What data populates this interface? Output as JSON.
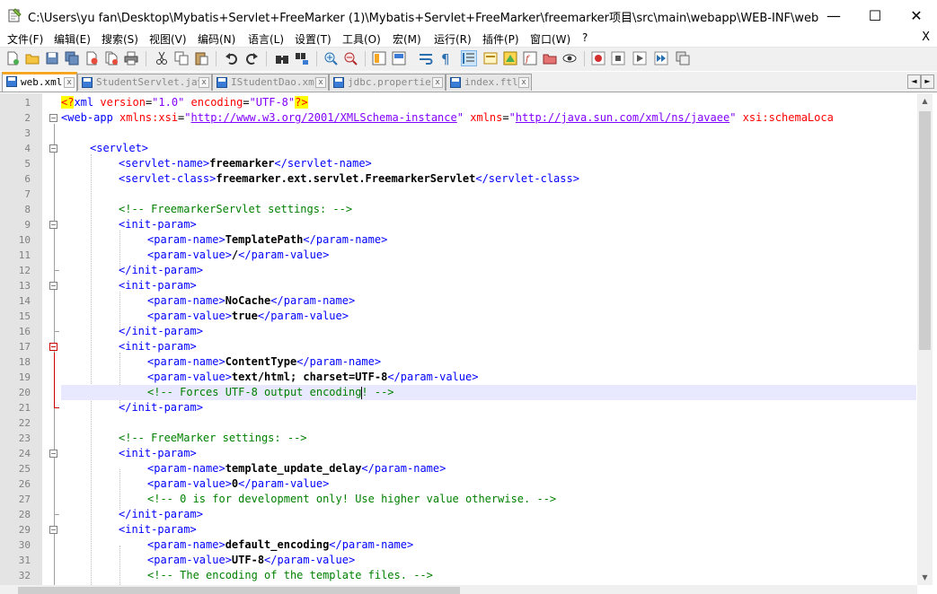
{
  "window": {
    "title": "C:\\Users\\yu   fan\\Desktop\\Mybatis+Servlet+FreeMarker (1)\\Mybatis+Servlet+FreeMarker\\freemarker项目\\src\\main\\webapp\\WEB-INF\\web.xml - Not...",
    "minimize": "—",
    "maximize": "☐",
    "close": "✕"
  },
  "menu": {
    "items": [
      "文件(F)",
      "编辑(E)",
      "搜索(S)",
      "视图(V)",
      "编码(N)",
      "语言(L)",
      "设置(T)",
      "工具(O)",
      "宏(M)",
      "运行(R)",
      "插件(P)",
      "窗口(W)",
      "?"
    ],
    "close": "X"
  },
  "toolbar": {
    "icons": [
      "new-file-icon",
      "open-file-icon",
      "save-icon",
      "save-all-icon",
      "close-icon",
      "close-all-icon",
      "print-icon",
      "cut-icon",
      "copy-icon",
      "paste-icon",
      "undo-icon",
      "redo-icon",
      "find-icon",
      "replace-icon",
      "zoom-in-icon",
      "zoom-out-icon",
      "sync-vertical-icon",
      "sync-horizontal-icon",
      "word-wrap-icon",
      "show-all-chars-icon",
      "indent-guide-icon",
      "user-language-icon",
      "doc-map-icon",
      "function-list-icon",
      "folder-workspace-icon",
      "monitoring-icon",
      "record-macro-icon",
      "stop-macro-icon",
      "play-macro-icon",
      "run-macro-multiple-icon",
      "save-macro-icon"
    ]
  },
  "tabs": [
    {
      "label": "web.xml",
      "active": true,
      "close": "x"
    },
    {
      "label": "StudentServlet.java",
      "active": false,
      "close": "x"
    },
    {
      "label": "IStudentDao.xml",
      "active": false,
      "close": "x"
    },
    {
      "label": "jdbc.properties",
      "active": false,
      "close": "x"
    },
    {
      "label": "index.ftl",
      "active": false,
      "close": "x"
    }
  ],
  "tab_nav": {
    "left": "◄",
    "right": "►"
  },
  "editor": {
    "current_line": 20,
    "lines": [
      {
        "n": "1"
      },
      {
        "n": "2"
      },
      {
        "n": "3"
      },
      {
        "n": "4"
      },
      {
        "n": "5"
      },
      {
        "n": "6"
      },
      {
        "n": "7"
      },
      {
        "n": "8"
      },
      {
        "n": "9"
      },
      {
        "n": "10"
      },
      {
        "n": "11"
      },
      {
        "n": "12"
      },
      {
        "n": "13"
      },
      {
        "n": "14"
      },
      {
        "n": "15"
      },
      {
        "n": "16"
      },
      {
        "n": "17"
      },
      {
        "n": "18"
      },
      {
        "n": "19"
      },
      {
        "n": "20"
      },
      {
        "n": "21"
      },
      {
        "n": "22"
      },
      {
        "n": "23"
      },
      {
        "n": "24"
      },
      {
        "n": "25"
      },
      {
        "n": "26"
      },
      {
        "n": "27"
      },
      {
        "n": "28"
      },
      {
        "n": "29"
      },
      {
        "n": "30"
      },
      {
        "n": "31"
      },
      {
        "n": "32"
      }
    ],
    "code": {
      "l1_open": "<?",
      "l1_xml": "xml",
      "l1_version_attr": " version",
      "l1_eq1": "=",
      "l1_version_val": "\"1.0\"",
      "l1_encoding_attr": " encoding",
      "l1_eq2": "=",
      "l1_encoding_val": "\"UTF-8\"",
      "l1_close": "?>",
      "l2_tag": "<web-app",
      "l2_attr1": " xmlns:xsi",
      "l2_eq1": "=",
      "l2_q1": "\"",
      "l2_url1": "http://www.w3.org/2001/XMLSchema-instance",
      "l2_q2": "\"",
      "l2_attr2": " xmlns",
      "l2_eq2": "=",
      "l2_q3": "\"",
      "l2_url2": "http://java.sun.com/xml/ns/javaee",
      "l2_q4": "\"",
      "l2_attr3": " xsi:schemaLoca",
      "l4": "<servlet>",
      "l5_open": "<servlet-name>",
      "l5_text": "freemarker",
      "l5_close": "</servlet-name>",
      "l6_open": "<servlet-class>",
      "l6_text": "freemarker.ext.servlet.FreemarkerServlet",
      "l6_close": "</servlet-class>",
      "l8": "<!-- FreemarkerServlet settings: -->",
      "l9": "<init-param>",
      "l10_open": "<param-name>",
      "l10_text": "TemplatePath",
      "l10_close": "</param-name>",
      "l11_open": "<param-value>",
      "l11_text": "/",
      "l11_close": "</param-value>",
      "l12": "</init-param>",
      "l13": "<init-param>",
      "l14_open": "<param-name>",
      "l14_text": "NoCache",
      "l14_close": "</param-name>",
      "l15_open": "<param-value>",
      "l15_text": "true",
      "l15_close": "</param-value>",
      "l16": "</init-param>",
      "l17": "<init-param>",
      "l18_open": "<param-name>",
      "l18_text": "ContentType",
      "l18_close": "</param-name>",
      "l19_open": "<param-value>",
      "l19_text": "text/html; charset=UTF-8",
      "l19_close": "</param-value>",
      "l20": "<!-- Forces UTF-8 output encoding! -->",
      "l21": "</init-param>",
      "l23": "<!-- FreeMarker settings: -->",
      "l24": "<init-param>",
      "l25_open": "<param-name>",
      "l25_text": "template_update_delay",
      "l25_close": "</param-name>",
      "l26_open": "<param-value>",
      "l26_text": "0",
      "l26_close": "</param-value>",
      "l27": "<!-- 0 is for development only! Use higher value otherwise. -->",
      "l28": "</init-param>",
      "l29": "<init-param>",
      "l30_open": "<param-name>",
      "l30_text": "default_encoding",
      "l30_close": "</param-name>",
      "l31_open": "<param-value>",
      "l31_text": "UTF-8",
      "l31_close": "</param-value>",
      "l32": "<!-- The encoding of the template files. -->"
    }
  },
  "colors": {
    "tag": "#0000ff",
    "attribute": "#ff0000",
    "value": "#8000ff",
    "comment": "#008000",
    "current_line_bg": "#e8e8ff",
    "active_tab_accent": "#f5a623"
  }
}
